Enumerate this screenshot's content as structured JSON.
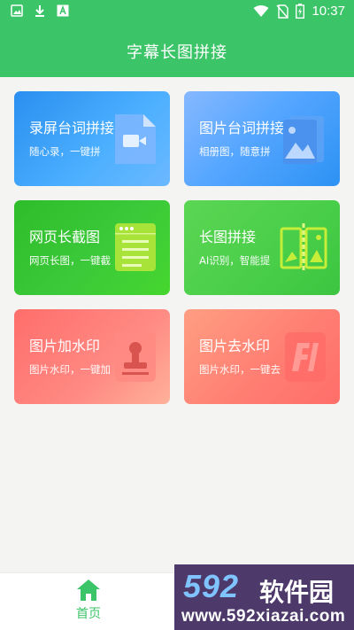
{
  "status_bar": {
    "time": "10:37",
    "left_icons": [
      "image-icon",
      "download-icon",
      "font-icon"
    ],
    "right_icons": [
      "wifi-icon",
      "no-sim-icon",
      "battery-charging-icon"
    ]
  },
  "app_bar": {
    "title": "字幕长图拼接"
  },
  "cards": [
    {
      "title": "录屏台词拼接",
      "subtitle": "随心录，一键拼",
      "icon": "video-file-icon"
    },
    {
      "title": "图片台词拼接",
      "subtitle": "相册图，随意拼",
      "icon": "photo-album-icon"
    },
    {
      "title": "网页长截图",
      "subtitle": "网页长图，一键截",
      "icon": "webpage-document-icon"
    },
    {
      "title": "长图拼接",
      "subtitle": "AI识别，智能提",
      "icon": "split-image-icon"
    },
    {
      "title": "图片加水印",
      "subtitle": "图片水印，一键加",
      "icon": "stamp-icon"
    },
    {
      "title": "图片去水印",
      "subtitle": "图片水印，一键去",
      "icon": "remove-watermark-icon"
    }
  ],
  "bottom_nav": {
    "home_label": "首页",
    "home_icon": "home-icon"
  },
  "watermark": {
    "number": "592",
    "brand": "软件园",
    "url": "www.592xiazai.com"
  },
  "colors": {
    "primary": "#3cc468"
  }
}
